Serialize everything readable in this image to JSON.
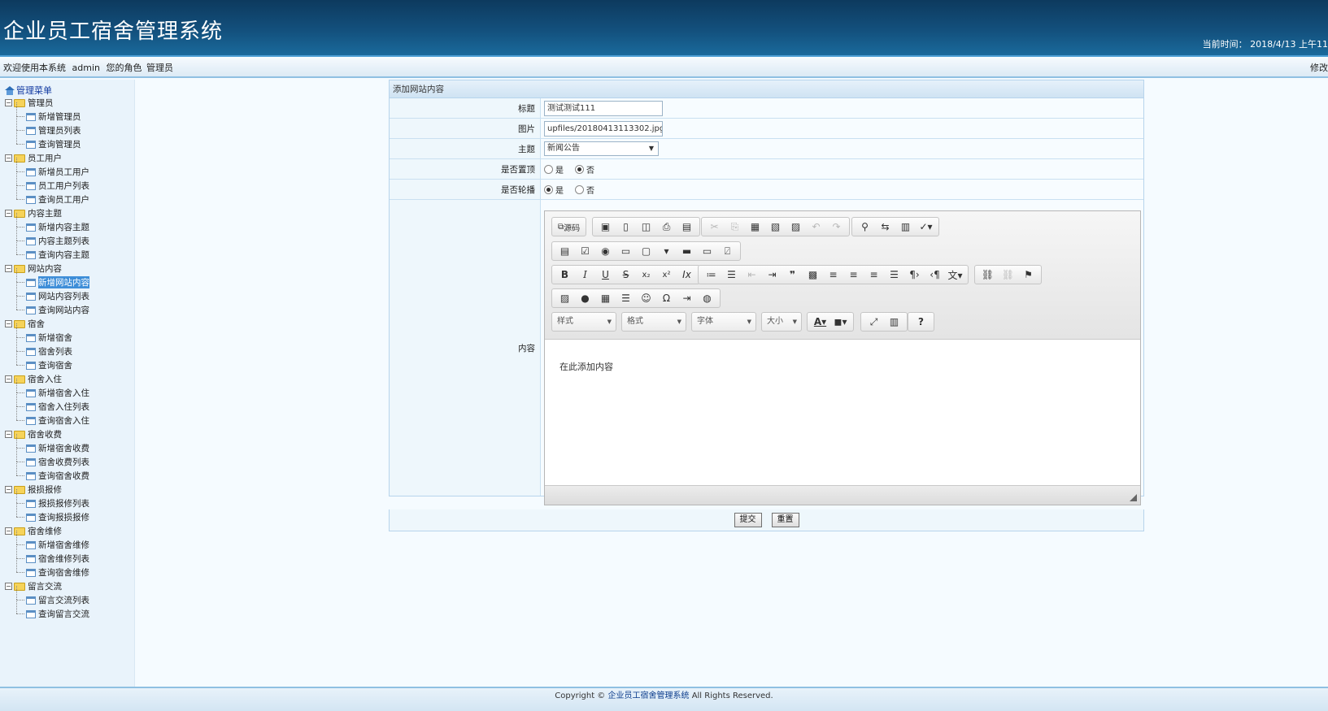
{
  "header": {
    "title": "企业员工宿舍管理系统",
    "time_label": "当前时间：",
    "time_value": "2018/4/13 上午11"
  },
  "welcome": {
    "text": "欢迎使用本系统",
    "user": "admin",
    "role_label": "您的角色",
    "role": "管理员",
    "right_link": "修改"
  },
  "sidebar": {
    "root": "管理菜单",
    "groups": [
      {
        "label": "管理员",
        "items": [
          "新增管理员",
          "管理员列表",
          "查询管理员"
        ]
      },
      {
        "label": "员工用户",
        "items": [
          "新增员工用户",
          "员工用户列表",
          "查询员工用户"
        ]
      },
      {
        "label": "内容主题",
        "items": [
          "新增内容主题",
          "内容主题列表",
          "查询内容主题"
        ]
      },
      {
        "label": "网站内容",
        "items": [
          "新增网站内容",
          "网站内容列表",
          "查询网站内容"
        ]
      },
      {
        "label": "宿舍",
        "items": [
          "新增宿舍",
          "宿舍列表",
          "查询宿舍"
        ]
      },
      {
        "label": "宿舍入住",
        "items": [
          "新增宿舍入住",
          "宿舍入住列表",
          "查询宿舍入住"
        ]
      },
      {
        "label": "宿舍收费",
        "items": [
          "新增宿舍收费",
          "宿舍收费列表",
          "查询宿舍收费"
        ]
      },
      {
        "label": "报损报修",
        "items": [
          "报损报修列表",
          "查询报损报修"
        ]
      },
      {
        "label": "宿舍维修",
        "items": [
          "新增宿舍维修",
          "宿舍维修列表",
          "查询宿舍维修"
        ]
      },
      {
        "label": "留言交流",
        "items": [
          "留言交流列表",
          "查询留言交流"
        ]
      }
    ],
    "selected": "新增网站内容"
  },
  "form": {
    "title": "添加网站内容",
    "fields": {
      "title_label": "标题",
      "title_value": "测试测试111",
      "image_label": "图片",
      "image_value": "upfiles/20180413113302.jpg",
      "topic_label": "主题",
      "topic_value": "新闻公告",
      "top_label": "是否置顶",
      "top_yes": "是",
      "top_no": "否",
      "top_selected": "否",
      "carousel_label": "是否轮播",
      "carousel_yes": "是",
      "carousel_no": "否",
      "carousel_selected": "是",
      "content_label": "内容"
    },
    "editor": {
      "source_label": "源码",
      "combo_style": "样式",
      "combo_format": "格式",
      "combo_font": "字体",
      "combo_size": "大小",
      "placeholder": "在此添加内容"
    },
    "submit_label": "提交",
    "reset_label": "重置"
  },
  "footer": {
    "prefix": "Copyright ©",
    "link": "企业员工宿舍管理系统",
    "suffix": "All Rights Reserved."
  }
}
